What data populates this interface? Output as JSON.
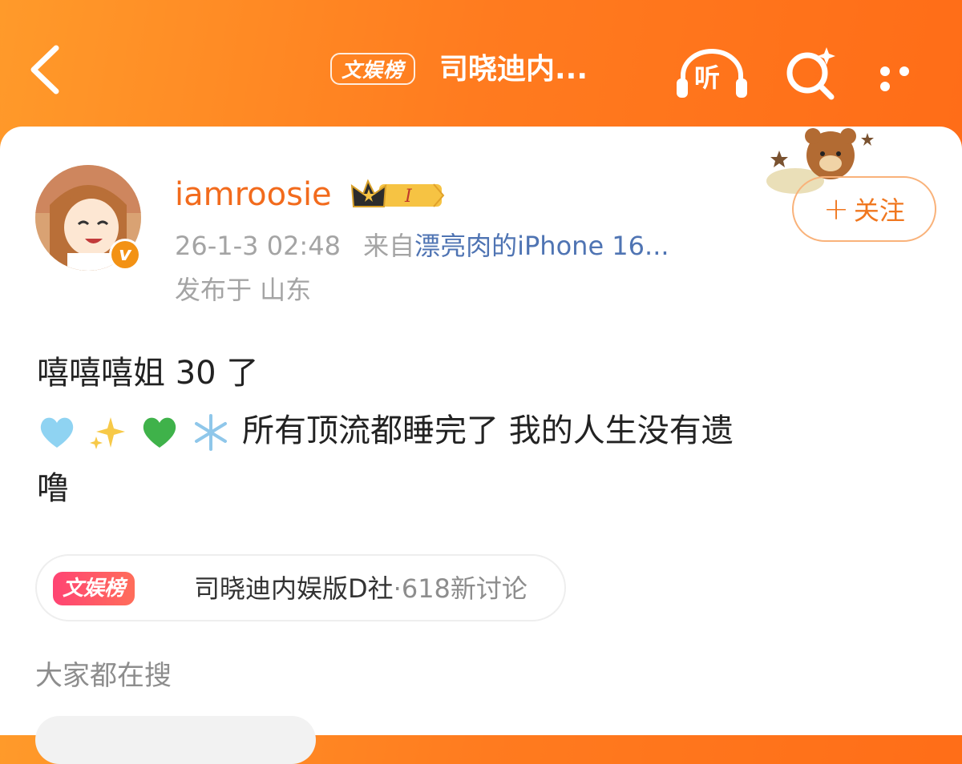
{
  "header": {
    "tag_label": "文娱榜",
    "title": "司晓迪内...",
    "listen_label": "听",
    "back_icon": "chevron-left-icon",
    "search_icon": "search-sparkle-icon",
    "more_icon": "more-dots-icon"
  },
  "post": {
    "username": "iamroosie",
    "level_badge": "I",
    "timestamp": "26-1-3 02:48",
    "source_prefix": "来自",
    "source_device": "漂亮肉的iPhone 16...",
    "location": "发布于 山东",
    "follow_label": "关注",
    "verified_mark": "v",
    "content_line1": "嘻嘻嘻姐 30 了",
    "content_line2": "所有顶流都睡完了 我的人生没有遗",
    "content_line3": "噜",
    "emojis": [
      "light-blue-heart",
      "sparkles",
      "green-heart",
      "snowflake"
    ]
  },
  "topic": {
    "tag_label": "文娱榜",
    "name": "司晓迪内娱版D社",
    "count": "·618新讨论"
  },
  "section": {
    "searching_title": "大家都在搜"
  },
  "colors": {
    "header_orange": "#ff7b1f",
    "username_orange": "#f26b1d",
    "source_blue": "#4f74b3",
    "topic_pink": "#ff4473"
  }
}
